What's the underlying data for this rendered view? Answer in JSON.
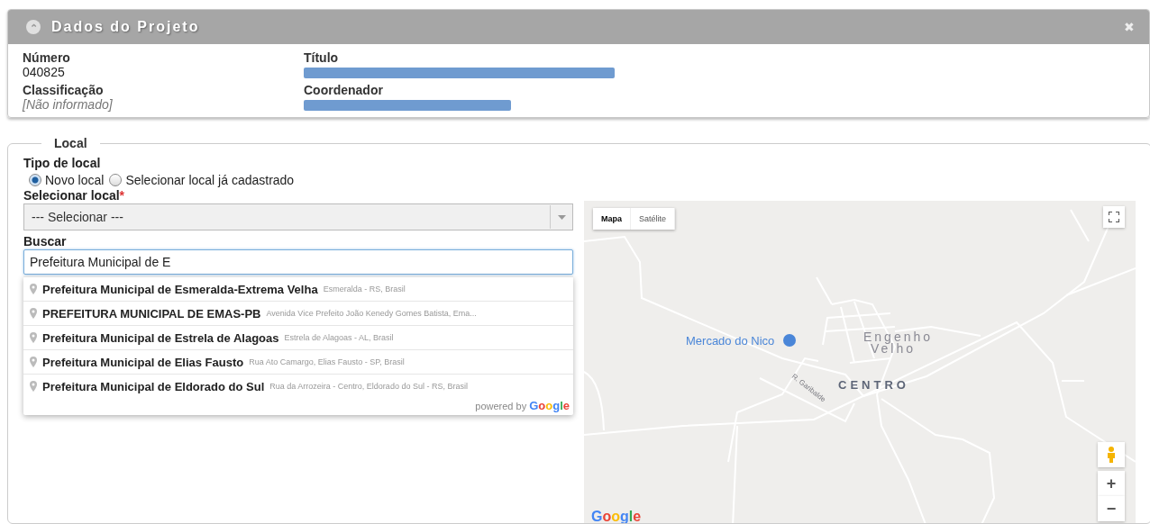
{
  "panel": {
    "title": "Dados do Projeto",
    "collapse_icon": "⌃",
    "close_icon": "✖",
    "fields": [
      {
        "label": "Número",
        "value": "040825",
        "redacted": false,
        "empty": false
      },
      {
        "label": "Título",
        "redacted": true
      },
      {
        "label": "Classificação",
        "value": "[Não informado]",
        "redacted": false,
        "empty": true
      },
      {
        "label": "Coordenador",
        "redacted": true
      }
    ]
  },
  "local": {
    "legend": "Local",
    "type_label": "Tipo de local",
    "radios": [
      {
        "label": "Novo local",
        "selected": true
      },
      {
        "label": "Selecionar local já cadastrado",
        "selected": false
      }
    ],
    "select": {
      "label": "Selecionar local",
      "required_mark": "*",
      "value": "--- Selecionar ---",
      "disabled": true
    },
    "search": {
      "label": "Buscar",
      "value": "Prefeitura Municipal de E"
    },
    "suggestions": [
      {
        "name": "Prefeitura Municipal de Esmeralda-Extrema Velha",
        "address": "Esmeralda - RS, Brasil"
      },
      {
        "name": "PREFEITURA MUNICIPAL DE EMAS-PB",
        "address": "Avenida Vice Prefeito João Kenedy Gomes Batista, Ema..."
      },
      {
        "name": "Prefeitura Municipal de Estrela de Alagoas",
        "address": "Estrela de Alagoas - AL, Brasil"
      },
      {
        "name": "Prefeitura Municipal de Elias Fausto",
        "address": "Rua Ato Camargo, Elias Fausto - SP, Brasil"
      },
      {
        "name": "Prefeitura Municipal de Eldorado do Sul",
        "address": "Rua da Arrozeira - Centro, Eldorado do Sul - RS, Brasil"
      }
    ],
    "powered_by": "powered by",
    "powered_brand": "Google"
  },
  "map": {
    "types": [
      {
        "label": "Mapa",
        "selected": true
      },
      {
        "label": "Satélite",
        "selected": false
      }
    ],
    "places": [
      {
        "label": "Mercado do Nico",
        "kind": "poi"
      },
      {
        "label": "Engenho",
        "kind": "area"
      },
      {
        "label": "Velho",
        "kind": "area"
      },
      {
        "label": "CENTRO",
        "kind": "district"
      },
      {
        "label": "R. Garibalde",
        "kind": "street"
      }
    ],
    "zoom_in": "+",
    "zoom_out": "−",
    "logo": "Google"
  }
}
